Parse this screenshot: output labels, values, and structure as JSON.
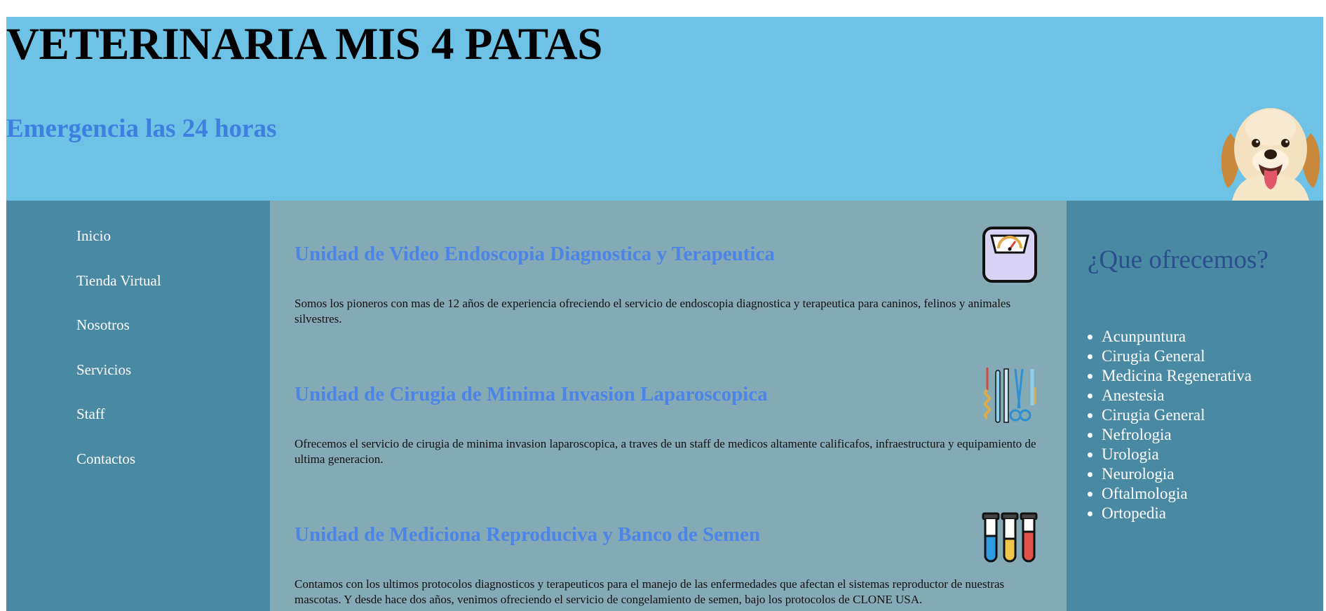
{
  "header": {
    "title": "VETERINARIA MIS 4 PATAS",
    "subtitle": "Emergencia las 24 horas"
  },
  "nav": {
    "items": [
      "Inicio",
      "Tienda Virtual",
      "Nosotros",
      "Servicios",
      "Staff",
      "Contactos"
    ]
  },
  "units": [
    {
      "title": "Unidad de Video Endoscopia Diagnostica y Terapeutica",
      "text": "Somos los pioneros con mas de 12 años de experiencia ofreciendo el servicio de endoscopia diagnostica y terapeutica para caninos, felinos y animales silvestres.",
      "icon": "weighing-scale-icon"
    },
    {
      "title": "Unidad de Cirugia de Minima Invasion Laparoscopica",
      "text": "Ofrecemos el servicio de cirugia de minima invasion laparoscopica, a traves de un staff de medicos altamente calificafos, infraestructura y equipamiento de ultima generacion.",
      "icon": "surgical-tools-icon"
    },
    {
      "title": "Unidad de Mediciona Reproduciva y Banco de Semen",
      "text": "Contamos con los ultimos protocolos diagnosticos y terapeuticos para el manejo de las enfermedades que afectan el sistemas reproductor de nuestras mascotas. Y desde hace dos años, venimos ofreciendo el servicio de congelamiento de semen, bajo los protocolos de CLONE USA.",
      "icon": "test-tubes-icon"
    }
  ],
  "offer": {
    "title": "¿Que ofrecemos?",
    "items": [
      "Acunpuntura",
      "Cirugia General",
      "Medicina Regenerativa",
      "Anestesia",
      "Cirugia General",
      "Nefrologia",
      "Urologia",
      "Neurologia",
      "Oftalmologia",
      "Ortopedia"
    ]
  },
  "colors": {
    "banner": "#6dc2e6",
    "sidebar": "#4a89a3",
    "content": "#84aab6",
    "heading_blue": "#4d84e8",
    "offer_title": "#2a4f8c"
  }
}
